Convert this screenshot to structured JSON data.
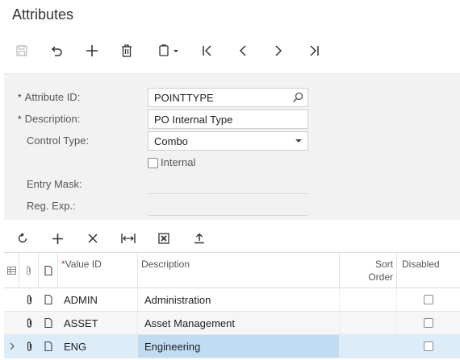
{
  "page": {
    "title": "Attributes"
  },
  "toolbar": {
    "buttons": [
      "save-icon",
      "undo-icon",
      "add-icon",
      "delete-icon",
      "copy-paste-icon",
      "first-icon",
      "previous-icon",
      "next-icon",
      "last-icon"
    ]
  },
  "form": {
    "attribute_id": {
      "label": "Attribute ID:",
      "value": "POINTTYPE",
      "required": "*"
    },
    "description": {
      "label": "Description:",
      "value": "PO Internal Type",
      "required": "*"
    },
    "control_type": {
      "label": "Control Type:",
      "value": "Combo"
    },
    "internal": {
      "label": "Internal"
    },
    "entry_mask": {
      "label": "Entry Mask:",
      "value": ""
    },
    "reg_exp": {
      "label": "Reg. Exp.:",
      "value": ""
    }
  },
  "grid_toolbar": {
    "buttons": [
      "refresh-icon",
      "add-row-icon",
      "delete-row-icon",
      "fit-columns-icon",
      "export-excel-icon",
      "upload-icon"
    ]
  },
  "grid": {
    "headers": {
      "value_id": "Value ID",
      "value_id_required": "*",
      "description": "Description",
      "sort_order_1": "Sort",
      "sort_order_2": "Order",
      "disabled": "Disabled"
    },
    "rows": [
      {
        "value_id": "ADMIN",
        "description": "Administration",
        "disabled": false
      },
      {
        "value_id": "ASSET",
        "description": "Asset Management",
        "disabled": false
      },
      {
        "value_id": "ENG",
        "description": "Engineering",
        "disabled": false,
        "selected": true
      }
    ]
  },
  "colors": {
    "selected_row": "#dcecf9",
    "form_background": "#f2f2f2"
  }
}
